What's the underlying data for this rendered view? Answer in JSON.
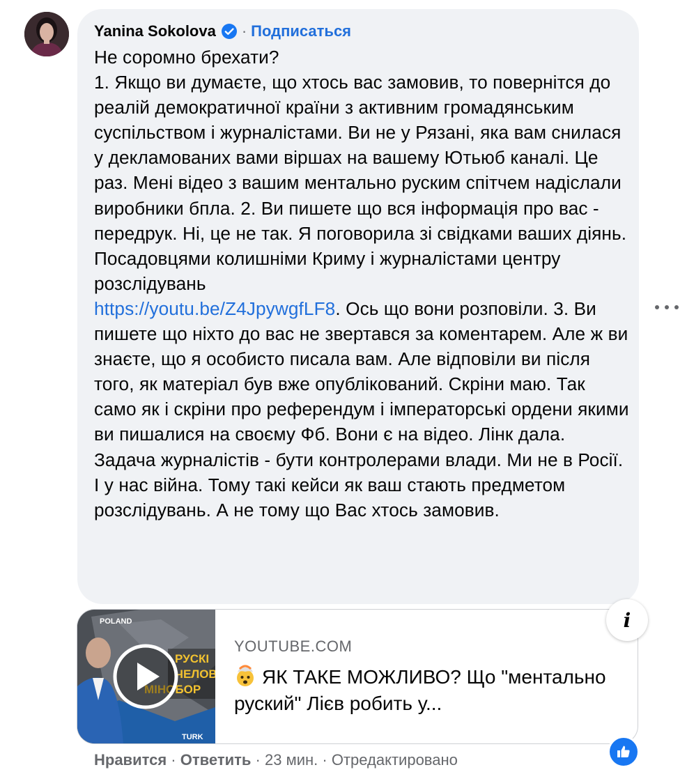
{
  "comment": {
    "author": "Yanina Sokolova",
    "separator": "·",
    "follow_label": "Подписаться",
    "text_part1": "Не соромно брехати?\n1. Якщо ви думаєте, що хтось вас замовив, то повернітся до реалій демократичної країни з активним громадянським суспільством і журналістами. Ви не у Рязані, яка вам снилася у декламованих вами віршах на вашему Ютьюб каналі. Це раз. Мені відео з вашим ментально руским спітчем надіслали виробники бпла. 2. Ви пишете що вся інформація про вас - передрук. Ні, це не так. Я поговорила зі свідками ваших діянь. Посадовцями колишніми Криму і журналістами центру розслідувань\n",
    "link_text": "https://youtu.be/Z4JpywgfLF8",
    "text_part2": ". Ось що вони розповіли. 3. Ви пишете що ніхто до вас не звертався за коментарем. Але ж ви знаєте, що я особисто писала вам. Але відповіли ви після того, як матеріал був вже опублікований. Скріни маю. Так само як і скріни про референдум і імператорські ордени якими ви пишалися на своєму Фб. Вони є на відео. Лінк дала. Задача журналістів - бути контролерами влади. Ми не в Росії. І у нас війна. Тому такі кейси як ваш стають предметом розслідувань. А не тому що Вас хтось замовив."
  },
  "link_preview": {
    "domain": "YOUTUBE.COM",
    "title": "ЯК ТАКЕ МОЖЛИВО? Що \"ментально руский\" Лієв робить у...",
    "thumbnail_texts": [
      "POLAND",
      "РУСКІ",
      "ЧЕЛОВ",
      "МІНОБОР",
      "TURK"
    ]
  },
  "actions": {
    "like": "Нравится",
    "reply": "Ответить",
    "time": "23 мин.",
    "edited": "Отредактировано"
  },
  "icons": {
    "verified": "verified-badge-icon",
    "more": "more-horizontal-icon",
    "info": "info-icon",
    "play": "play-icon",
    "like": "thumbs-up-icon"
  },
  "colors": {
    "link": "#216fdb",
    "bubble": "#f0f2f5",
    "secondary_text": "#65676b",
    "like_blue": "#1877f2"
  }
}
